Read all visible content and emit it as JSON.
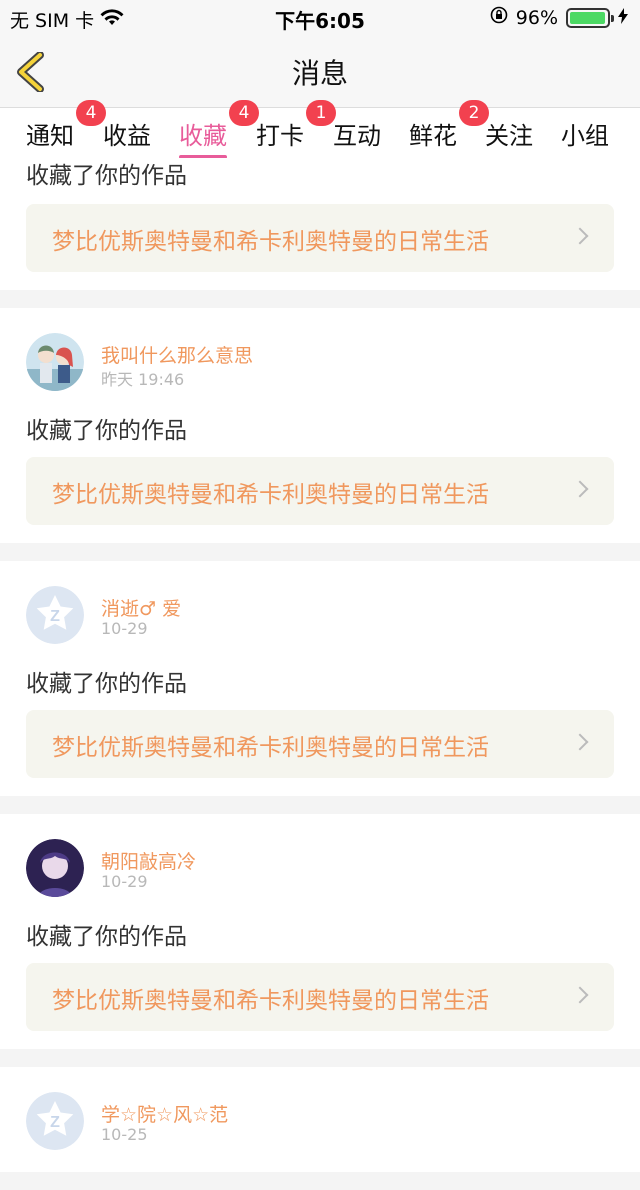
{
  "status_bar": {
    "carrier": "无 SIM 卡",
    "time": "下午6:05",
    "battery": "96%",
    "battery_level": 0.96
  },
  "nav": {
    "title": "消息",
    "back_icon": "chevron-left-icon"
  },
  "tabs": [
    {
      "label": "通知",
      "badge": "4"
    },
    {
      "label": "收益",
      "badge": ""
    },
    {
      "label": "收藏",
      "badge": "4"
    },
    {
      "label": "打卡",
      "badge": "1"
    },
    {
      "label": "互动",
      "badge": ""
    },
    {
      "label": "鲜花",
      "badge": "2"
    },
    {
      "label": "关注",
      "badge": ""
    },
    {
      "label": "小组",
      "badge": ""
    }
  ],
  "active_tab": "收藏",
  "first_card": {
    "action": "收藏了你的作品",
    "work": "梦比优斯奥特曼和希卡利奥特曼的日常生活"
  },
  "messages": [
    {
      "user": "我叫什么那么意思",
      "time": "昨天 19:46",
      "action": "收藏了你的作品",
      "work": "梦比优斯奥特曼和希卡利奥特曼的日常生活",
      "avatar": "anime"
    },
    {
      "user": "消逝♂ 爱",
      "time": "10-29",
      "action": "收藏了你的作品",
      "work": "梦比优斯奥特曼和希卡利奥特曼的日常生活",
      "avatar": "default"
    },
    {
      "user": "朝阳敲高冷",
      "time": "10-29",
      "action": "收藏了你的作品",
      "work": "梦比优斯奥特曼和希卡利奥特曼的日常生活",
      "avatar": "dark"
    },
    {
      "user": "学☆院☆风☆范",
      "time": "10-25",
      "action": "",
      "work": "",
      "avatar": "default"
    }
  ]
}
